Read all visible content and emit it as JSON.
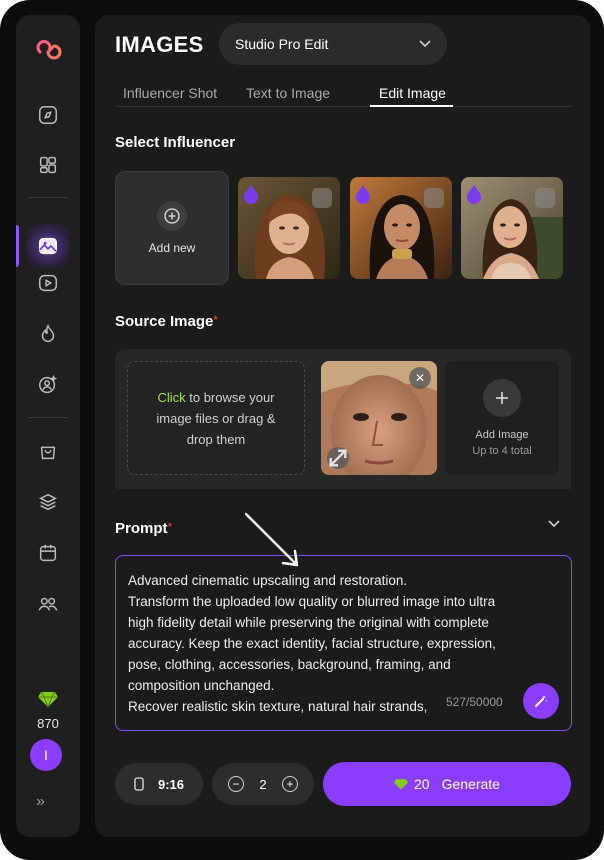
{
  "sidebar": {
    "credits": "870",
    "avatar_initial": "I",
    "expand_label": "»",
    "nav_icons": [
      "compass-icon",
      "grid-icon",
      "image-icon",
      "video-icon",
      "flame-icon",
      "user-star-icon",
      "bag-icon",
      "layers-icon",
      "calendar-icon",
      "users-icon"
    ],
    "active_item": "image-icon"
  },
  "header": {
    "title": "IMAGES",
    "model": "Studio Pro Edit"
  },
  "tabs": [
    {
      "label": "Influencer Shot",
      "active": false
    },
    {
      "label": "Text to Image",
      "active": false
    },
    {
      "label": "Edit Image",
      "active": true
    }
  ],
  "influencer": {
    "title": "Select Influencer",
    "add_new_label": "Add new"
  },
  "source": {
    "title": "Source Image",
    "required_mark": "*",
    "dropzone_click": "Click",
    "dropzone_text": " to browse your image files or drag & drop them",
    "add_image_label": "Add Image",
    "add_image_limit": "Up to 4 total",
    "remove_label": "✕"
  },
  "prompt": {
    "title": "Prompt",
    "required_mark": "*",
    "text": "Advanced cinematic upscaling and restoration.\nTransform the uploaded low quality or blurred image into ultra high fidelity detail while preserving the original with complete accuracy. Keep the exact identity, facial structure, expression, pose, clothing, accessories, background, framing, and composition unchanged.\nRecover realistic skin texture, natural hair strands,",
    "char_count": "527/50000"
  },
  "controls": {
    "aspect_ratio": "9:16",
    "image_count": "2",
    "minus": "−",
    "plus": "+",
    "generate_cost": "20",
    "generate_label": "Generate"
  },
  "colors": {
    "accent": "#8b3dff",
    "gem": "#84cc16",
    "required": "#ef4444",
    "click_link": "#a3e635"
  }
}
